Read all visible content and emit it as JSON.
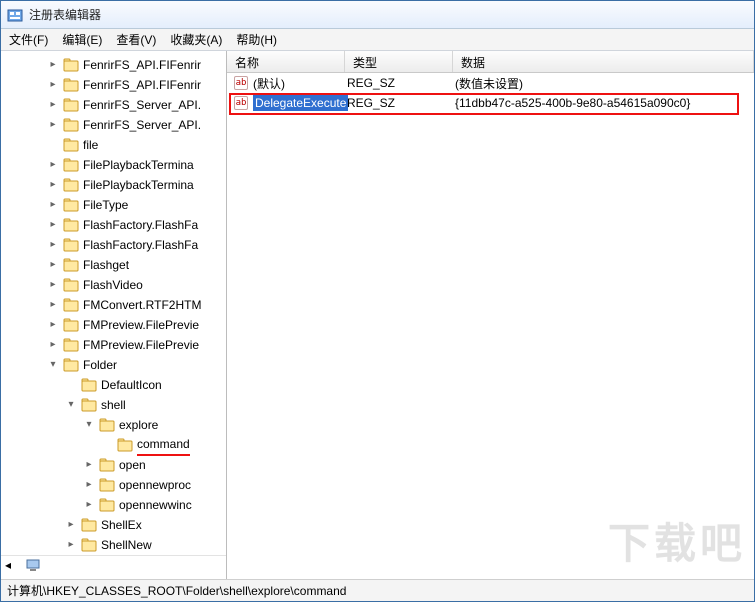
{
  "window": {
    "title": "注册表编辑器"
  },
  "menu": {
    "file": "文件(F)",
    "edit": "编辑(E)",
    "view": "查看(V)",
    "favorites": "收藏夹(A)",
    "help": "帮助(H)"
  },
  "tree": {
    "items": [
      {
        "label": "FenrirFS_API.FIFenrir",
        "depth": 1,
        "arrow": "▷"
      },
      {
        "label": "FenrirFS_API.FIFenrir",
        "depth": 1,
        "arrow": "▷"
      },
      {
        "label": "FenrirFS_Server_API.",
        "depth": 1,
        "arrow": "▷"
      },
      {
        "label": "FenrirFS_Server_API.",
        "depth": 1,
        "arrow": "▷"
      },
      {
        "label": "file",
        "depth": 1,
        "arrow": ""
      },
      {
        "label": "FilePlaybackTermina",
        "depth": 1,
        "arrow": "▷"
      },
      {
        "label": "FilePlaybackTermina",
        "depth": 1,
        "arrow": "▷"
      },
      {
        "label": "FileType",
        "depth": 1,
        "arrow": "▷"
      },
      {
        "label": "FlashFactory.FlashFa",
        "depth": 1,
        "arrow": "▷"
      },
      {
        "label": "FlashFactory.FlashFa",
        "depth": 1,
        "arrow": "▷"
      },
      {
        "label": "Flashget",
        "depth": 1,
        "arrow": "▷"
      },
      {
        "label": "FlashVideo",
        "depth": 1,
        "arrow": "▷"
      },
      {
        "label": "FMConvert.RTF2HTM",
        "depth": 1,
        "arrow": "▷"
      },
      {
        "label": "FMPreview.FilePrevie",
        "depth": 1,
        "arrow": "▷"
      },
      {
        "label": "FMPreview.FilePrevie",
        "depth": 1,
        "arrow": "▷"
      },
      {
        "label": "Folder",
        "depth": 1,
        "arrow": "▢"
      },
      {
        "label": "DefaultIcon",
        "depth": 2,
        "arrow": ""
      },
      {
        "label": "shell",
        "depth": 2,
        "arrow": "▢"
      },
      {
        "label": "explore",
        "depth": 3,
        "arrow": "▢"
      },
      {
        "label": "command",
        "depth": 4,
        "arrow": "",
        "underline": true
      },
      {
        "label": "open",
        "depth": 3,
        "arrow": "▷"
      },
      {
        "label": "opennewproc",
        "depth": 3,
        "arrow": "▷"
      },
      {
        "label": "opennewwinc",
        "depth": 3,
        "arrow": "▷"
      },
      {
        "label": "ShellEx",
        "depth": 2,
        "arrow": "▷"
      },
      {
        "label": "ShellNew",
        "depth": 2,
        "arrow": "▷"
      }
    ]
  },
  "columns": {
    "name": "名称",
    "type": "类型",
    "data": "数据"
  },
  "rows": [
    {
      "name": "(默认)",
      "type": "REG_SZ",
      "data": "(数值未设置)",
      "selected": false
    },
    {
      "name": "DelegateExecute",
      "type": "REG_SZ",
      "data": "{11dbb47c-a525-400b-9e80-a54615a090c0}",
      "selected": true
    }
  ],
  "statusbar": {
    "path": "计算机\\HKEY_CLASSES_ROOT\\Folder\\shell\\explore\\command"
  },
  "watermark": "下载吧"
}
